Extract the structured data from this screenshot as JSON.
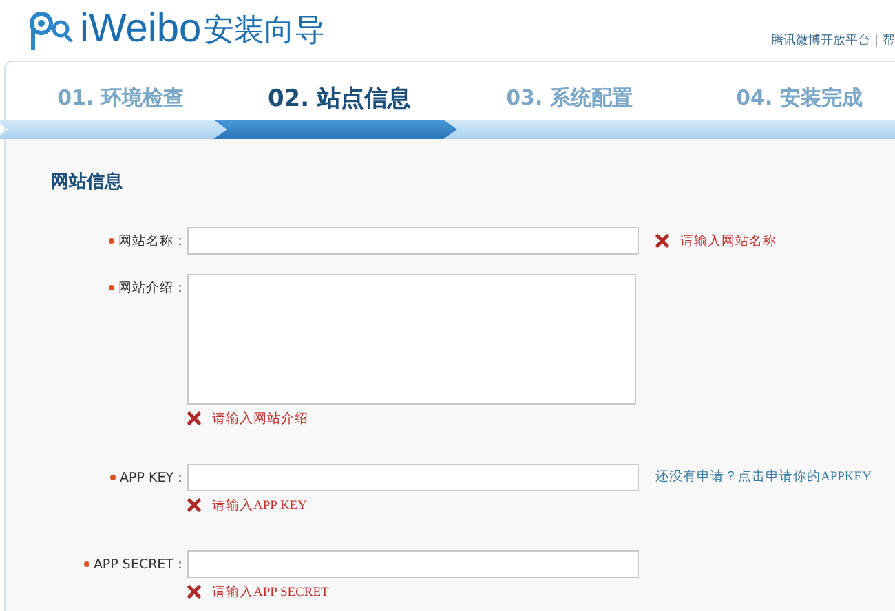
{
  "header": {
    "logo_text": "iWeibo",
    "title": "安装向导",
    "links": [
      "腾讯微博开放平台",
      "帮"
    ]
  },
  "steps": [
    {
      "label": "01. 环境检查",
      "selected": false
    },
    {
      "label": "02. 站点信息",
      "selected": true
    },
    {
      "label": "03. 系统配置",
      "selected": false
    },
    {
      "label": "04. 安装完成",
      "selected": false
    }
  ],
  "section_title": "网站信息",
  "fields": [
    {
      "label": "网站名称：",
      "kind": "input",
      "required": true,
      "error": "请输入网站名称",
      "error_inline": true
    },
    {
      "label": "网站介绍：",
      "kind": "textarea",
      "required": true,
      "error": "请输入网站介绍",
      "error_inline": false
    },
    {
      "label": "APP KEY：",
      "kind": "input",
      "required": true,
      "error": "请输入APP KEY",
      "error_inline": false,
      "link": "还没有申请？点击申请你的APPKEY"
    },
    {
      "label": "APP SECRET：",
      "kind": "input",
      "required": true,
      "error": "请输入APP SECRET",
      "error_inline": false
    }
  ]
}
